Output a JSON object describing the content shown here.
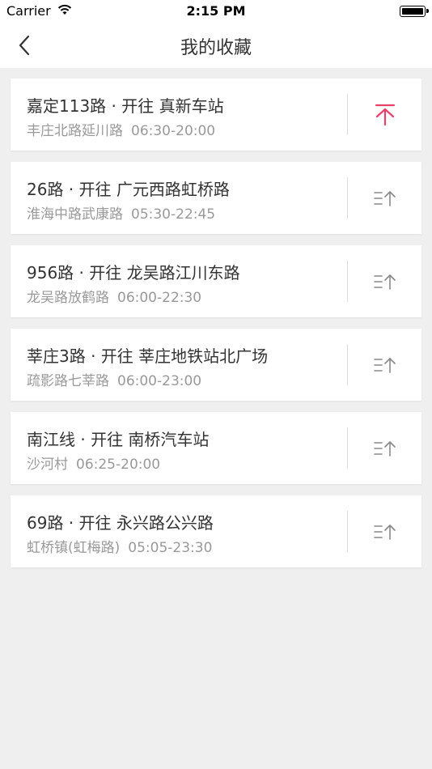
{
  "status_bar": {
    "carrier": "Carrier",
    "time": "2:15 PM"
  },
  "nav": {
    "title": "我的收藏",
    "back_icon": "chevron-left-icon"
  },
  "colors": {
    "accent_pinned": "#e8416a",
    "icon_default": "#888888",
    "title_text": "#333333",
    "sub_text": "#999999",
    "background": "#efefef"
  },
  "favorites": [
    {
      "title": "嘉定113路 · 开往 真新车站",
      "stop": "丰庄北路延川路",
      "hours": "06:30-20:00",
      "pinned": true
    },
    {
      "title": "26路 · 开往 广元西路虹桥路",
      "stop": "淮海中路武康路",
      "hours": "05:30-22:45",
      "pinned": false
    },
    {
      "title": "956路 · 开往 龙吴路江川东路",
      "stop": "龙吴路放鹤路",
      "hours": "06:00-22:30",
      "pinned": false
    },
    {
      "title": "莘庄3路 · 开往 莘庄地铁站北广场",
      "stop": "疏影路七莘路",
      "hours": "06:00-23:00",
      "pinned": false
    },
    {
      "title": "南江线 · 开往 南桥汽车站",
      "stop": "沙河村",
      "hours": "06:25-20:00",
      "pinned": false
    },
    {
      "title": "69路 · 开往 永兴路公兴路",
      "stop": "虹桥镇(虹梅路)",
      "hours": "05:05-23:30",
      "pinned": false
    }
  ]
}
